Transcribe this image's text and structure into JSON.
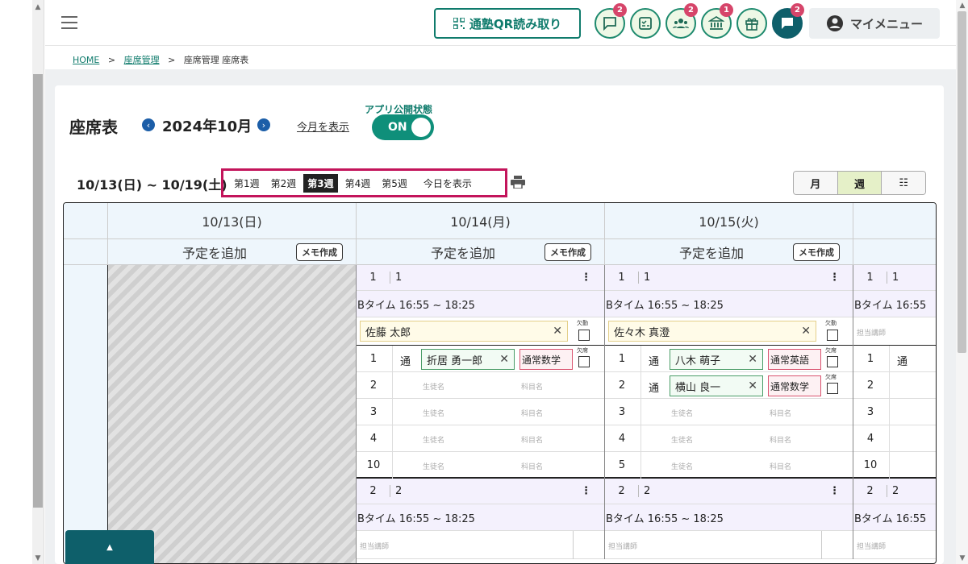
{
  "header": {
    "qr_label": "通塾QR読み取り",
    "icons": [
      {
        "name": "message-icon",
        "badge": "2"
      },
      {
        "name": "checklist-icon",
        "badge": ""
      },
      {
        "name": "group-icon",
        "badge": "2"
      },
      {
        "name": "bank-icon",
        "badge": "1"
      },
      {
        "name": "gift-icon",
        "badge": ""
      },
      {
        "name": "chat-icon",
        "badge": "2"
      }
    ],
    "mymenu_label": "マイメニュー"
  },
  "breadcrumb": {
    "home": "HOME",
    "sep1": ">",
    "seat_mgmt": "座席管理",
    "sep2": ">",
    "current": "座席管理 座席表"
  },
  "page": {
    "title": "座席表",
    "prev": "‹",
    "month": "2024年10月",
    "next": "›",
    "show_this_month": "今月を表示",
    "publish_label": "アプリ公開状態",
    "publish_state": "ON"
  },
  "week": {
    "range": "10/13(日) ~ 10/19(土)",
    "tabs": [
      "第1週",
      "第2週",
      "第3週",
      "第4週",
      "第5週"
    ],
    "today": "今日を表示"
  },
  "view": {
    "month": "月",
    "week": "週",
    "list": "☷"
  },
  "days": [
    {
      "date": "10/13(日)",
      "add": "予定を追加",
      "memo": "メモ作成"
    },
    {
      "date": "10/14(月)",
      "add": "予定を追加",
      "memo": "メモ作成"
    },
    {
      "date": "10/15(火)",
      "add": "予定を追加",
      "memo": "メモ作成"
    }
  ],
  "schedule": {
    "slot1_num": "1",
    "slot1_val": "1",
    "slot2_num": "2",
    "slot2_val": "2",
    "time": "Bタイム 16:55 ~ 18:25",
    "time_cut": "Bタイム 16:55",
    "absent_work": "欠勤",
    "absent": "欠席",
    "teacher_placeholder": "担当講師",
    "student_placeholder": "生徒名",
    "subject_placeholder": "科目名",
    "kind": "通",
    "mon": {
      "teacher": "佐藤 太郎",
      "rows": [
        {
          "num": "1",
          "student": "折居 勇一郎",
          "subject": "通常数学"
        },
        {
          "num": "2"
        },
        {
          "num": "3"
        },
        {
          "num": "4"
        },
        {
          "num": "10"
        }
      ]
    },
    "tue": {
      "teacher": "佐々木 真澄",
      "rows": [
        {
          "num": "1",
          "student": "八木 萌子",
          "subject": "通常英語"
        },
        {
          "num": "2",
          "student": "横山 良一",
          "subject": "通常数学"
        },
        {
          "num": "3"
        },
        {
          "num": "4"
        },
        {
          "num": "5"
        }
      ]
    },
    "wed_rows": [
      "1",
      "2",
      "3",
      "4",
      "10"
    ]
  },
  "colors": {
    "accent": "#0f7b6c",
    "highlight": "#c3145b",
    "badge": "#d6456a"
  }
}
